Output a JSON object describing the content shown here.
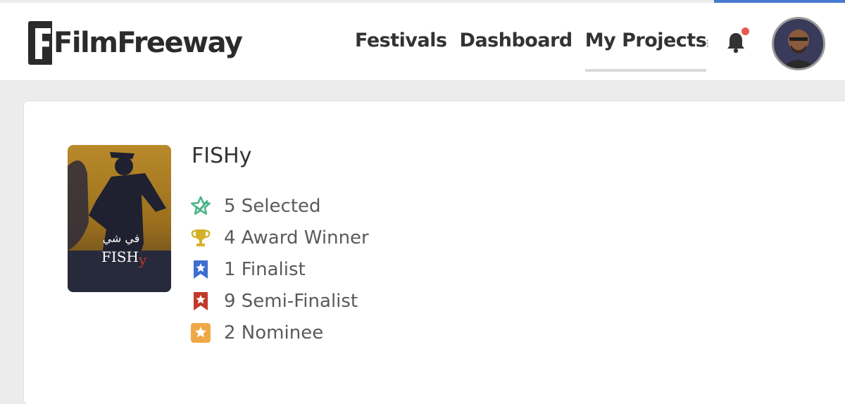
{
  "brand": {
    "logo_text": "FilmFreeway"
  },
  "nav": {
    "items": [
      {
        "label": "Festivals",
        "active": false
      },
      {
        "label": "Dashboard",
        "active": false
      },
      {
        "label": "My Projects",
        "active": true
      }
    ]
  },
  "header": {
    "notification_icon": "bell-icon",
    "has_notification": true,
    "accent_color": "#4a7ad0"
  },
  "project": {
    "title": "FISHy",
    "poster_text": {
      "arabic": "في شي",
      "latin": "FISH",
      "accent_letter": "y"
    },
    "stats": [
      {
        "label": "5 Selected",
        "icon": "selected-star-icon",
        "color": "#4cb38a"
      },
      {
        "label": "4 Award Winner",
        "icon": "trophy-icon",
        "color": "#d4b12a"
      },
      {
        "label": "1 Finalist",
        "icon": "finalist-ribbon-icon",
        "color": "#3d6fd1"
      },
      {
        "label": "9 Semi-Finalist",
        "icon": "semi-finalist-ribbon-icon",
        "color": "#c0392b"
      },
      {
        "label": "2 Nominee",
        "icon": "nominee-star-icon",
        "color": "#f0a846"
      }
    ]
  }
}
